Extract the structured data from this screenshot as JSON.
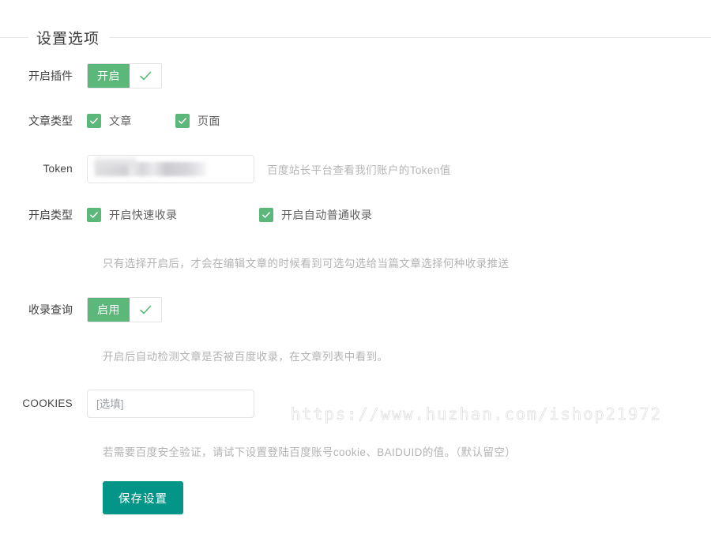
{
  "section": {
    "title": "设置选项"
  },
  "rows": {
    "plugin_enable": {
      "label": "开启插件",
      "switch_label": "开启",
      "state": "on"
    },
    "post_type": {
      "label": "文章类型",
      "options": [
        {
          "label": "文章",
          "checked": true
        },
        {
          "label": "页面",
          "checked": true
        }
      ]
    },
    "token": {
      "label": "Token",
      "value": "",
      "value_redacted": true,
      "placeholder": "",
      "hint": "百度站长平台查看我们账户的Token值"
    },
    "push_type": {
      "label": "开启类型",
      "options": [
        {
          "label": "开启快速收录",
          "checked": true
        },
        {
          "label": "开启自动普通收录",
          "checked": true
        }
      ],
      "hint": "只有选择开启后，才会在编辑文章的时候看到可选勾选给当篇文章选择何种收录推送"
    },
    "index_query": {
      "label": "收录查询",
      "switch_label": "启用",
      "state": "on",
      "hint": "开启后自动检测文章是否被百度收录，在文章列表中看到。"
    },
    "cookies": {
      "label": "COOKIES",
      "value": "",
      "placeholder": "[选填]",
      "hint": "若需要百度安全验证，请试下设置登陆百度账号cookie、BAIDUID的值。（默认留空）"
    }
  },
  "actions": {
    "save_label": "保存设置"
  },
  "watermark": {
    "text": "https://www.huzhan.com/ishop21972"
  },
  "colors": {
    "accent_green": "#5cb87a",
    "save_teal": "#039688",
    "rule": "#e6e6e6",
    "hint_gray": "#b3b3b3"
  }
}
